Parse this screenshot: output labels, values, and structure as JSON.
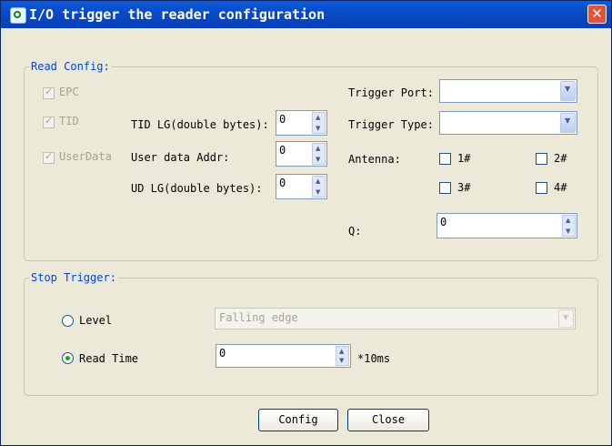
{
  "window": {
    "title": "I/O trigger the reader configuration"
  },
  "read_config": {
    "title": "Read Config:",
    "epc": {
      "label": "EPC",
      "checked": true,
      "enabled": false
    },
    "tid": {
      "label": "TID",
      "checked": true,
      "enabled": false
    },
    "userdata": {
      "label": "UserData",
      "checked": true,
      "enabled": false
    },
    "tid_lg": {
      "label": "TID LG(double bytes):",
      "value": "0"
    },
    "user_data_addr": {
      "label": "User data Addr:",
      "value": "0"
    },
    "ud_lg": {
      "label": "UD LG(double bytes):",
      "value": "0"
    },
    "trigger_port": {
      "label": "Trigger Port:",
      "value": ""
    },
    "trigger_type": {
      "label": "Trigger Type:",
      "value": ""
    },
    "antenna": {
      "label": "Antenna:",
      "items": [
        {
          "label": "1#",
          "checked": false
        },
        {
          "label": "2#",
          "checked": false
        },
        {
          "label": "3#",
          "checked": false
        },
        {
          "label": "4#",
          "checked": false
        }
      ]
    },
    "q": {
      "label": "Q:",
      "value": "0"
    }
  },
  "stop_trigger": {
    "title": "Stop Trigger:",
    "level": {
      "label": "Level",
      "selected": false,
      "value": "Falling edge"
    },
    "read_time": {
      "label": "Read Time",
      "selected": true,
      "value": "0",
      "unit": "*10ms"
    }
  },
  "buttons": {
    "config": "Config",
    "close": "Close"
  },
  "icons": {
    "title": "app-icon",
    "close": "close-icon"
  }
}
